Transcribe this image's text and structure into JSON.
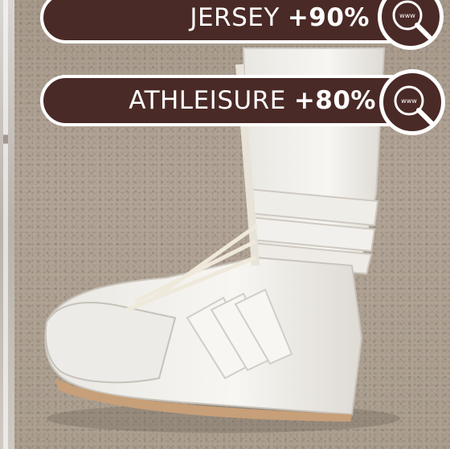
{
  "tags": [
    {
      "label": "JERSEY",
      "value": "+90%",
      "icon": "web-search-icon"
    },
    {
      "label": "ATHLEISURE",
      "value": "+80%",
      "icon": "web-search-icon"
    }
  ],
  "badge_text": "www",
  "colors": {
    "pill_background": "#4a2a26",
    "pill_border": "#ffffff",
    "text": "#ffffff",
    "ground": "#ab9f90",
    "shoe": "#f4f3ef"
  }
}
